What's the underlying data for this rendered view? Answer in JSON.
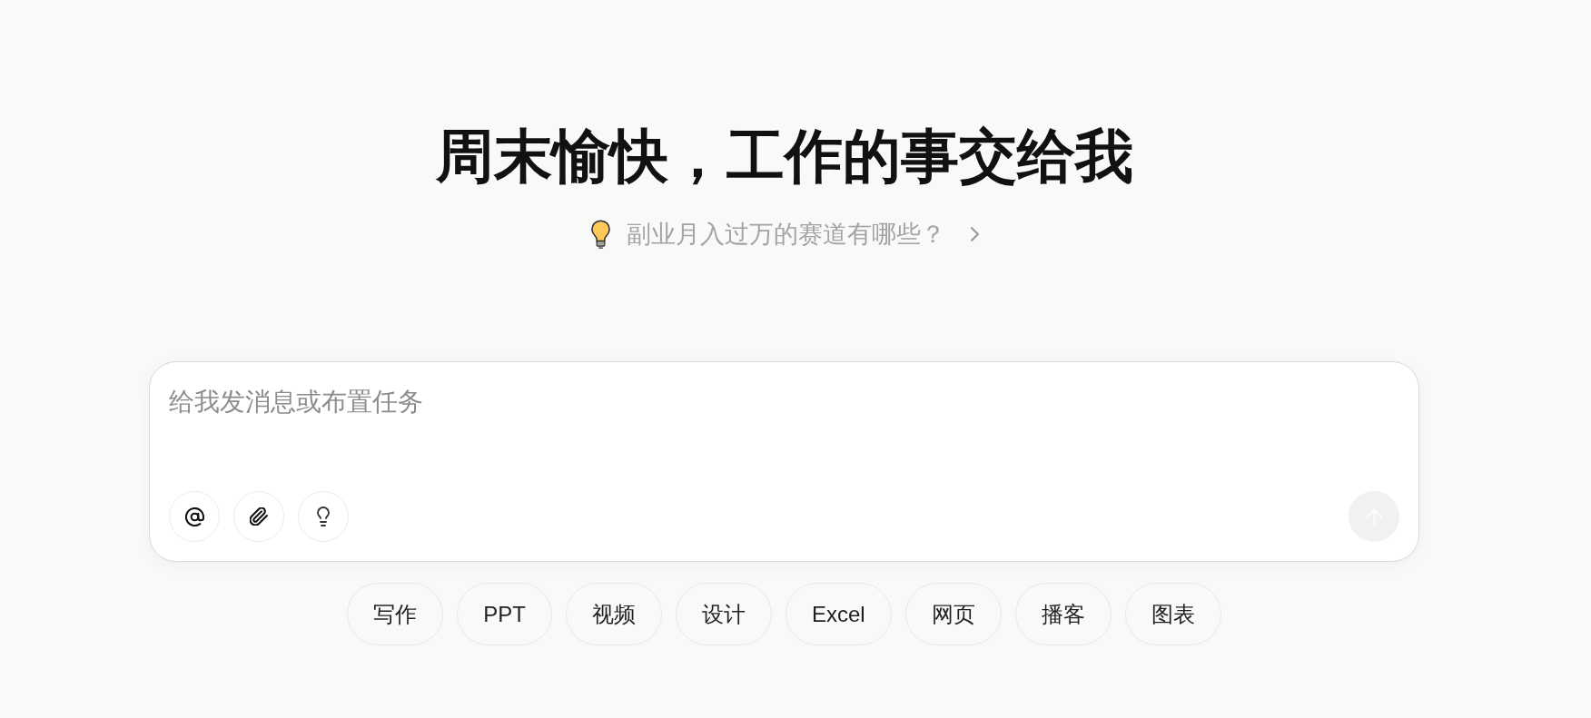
{
  "heading": {
    "title": "周末愉快，工作的事交给我"
  },
  "suggestion": {
    "text": "副业月入过万的赛道有哪些？"
  },
  "composer": {
    "placeholder": "给我发消息或布置任务",
    "send_button": {
      "disabled": true
    }
  },
  "shortcuts": [
    {
      "label": "写作"
    },
    {
      "label": "PPT"
    },
    {
      "label": "视频"
    },
    {
      "label": "设计"
    },
    {
      "label": "Excel"
    },
    {
      "label": "网页"
    },
    {
      "label": "播客"
    },
    {
      "label": "图表"
    }
  ]
}
